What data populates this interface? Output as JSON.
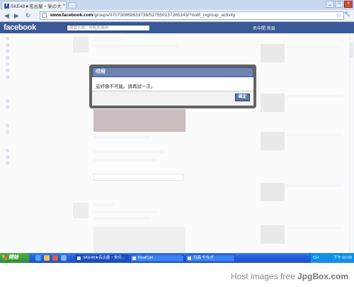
{
  "browser": {
    "tab_title": "SKE48★名古屋・栄の大",
    "tab_favicon": "f",
    "tab_close": "×",
    "url_host": "www.facebook.com",
    "url_path": "/groups/370730869633738/527550137285143/?notif_t=group_activity",
    "star_icon": "☆",
    "wrench_icon": "🔧",
    "nav_back": "◀",
    "nav_forward": "▶",
    "nav_reload": "↻",
    "window_controls": [
      "_",
      "□",
      "×"
    ]
  },
  "facebook": {
    "logo": "facebook",
    "search_placeholder": "搜尋人物、地點和事物",
    "user_label": "名中間 首頁"
  },
  "dialog": {
    "title": "哎呀",
    "message": "這好像不可能。請再試一次。",
    "ok_label": "確定"
  },
  "taskbar": {
    "start_label": "開始",
    "tasks": [
      "SKE48★名古屋・栄の...",
      "RealCall",
      "月森 やなぎ"
    ],
    "tray_lang": "CH",
    "clock": "下午 10:02"
  },
  "watermark": {
    "prefix": "Host images free ",
    "brand": "JpgBox.com"
  },
  "colors": {
    "fb_blue": "#3b5998",
    "dialog_title_bg": "#6d84b4",
    "taskbar_blue": "#245edb",
    "start_green": "#2f8c2f"
  }
}
